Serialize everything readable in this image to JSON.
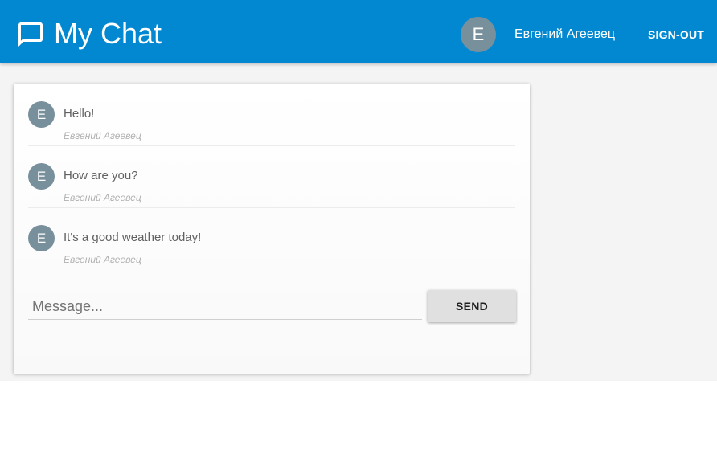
{
  "header": {
    "title": "My Chat",
    "brand_icon": "chat-bubble-icon",
    "user": {
      "avatar_letter": "E",
      "name": "Евгений Агеевец"
    },
    "signout_label": "SIGN-OUT"
  },
  "chat": {
    "messages": [
      {
        "avatar_letter": "E",
        "text": "Hello!",
        "author": "Евгений Агеевец"
      },
      {
        "avatar_letter": "E",
        "text": "How are you?",
        "author": "Евгений Агеевец"
      },
      {
        "avatar_letter": "E",
        "text": "It's a good weather today!",
        "author": "Евгений Агеевец"
      }
    ],
    "input": {
      "placeholder": "Message...",
      "value": ""
    },
    "send_label": "SEND"
  },
  "colors": {
    "appbar": "#0288d1",
    "avatar": "#78909c",
    "page_background": "#f4f4f4",
    "button": "#e0e0e0"
  }
}
